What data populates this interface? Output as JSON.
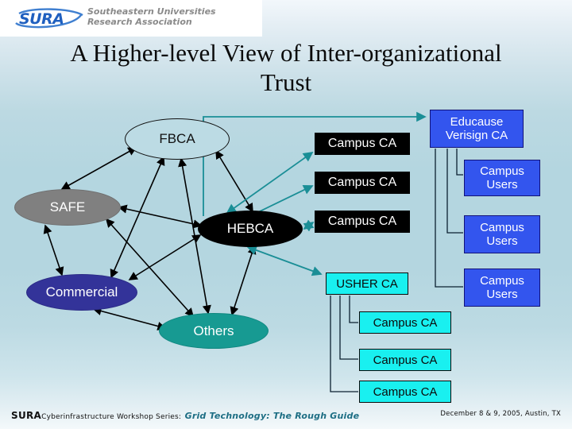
{
  "slide": {
    "title": "A Higher-level View of\nInter-organizational Trust",
    "background_top": "#f2f7fb",
    "background_mid": "#b4d6e0"
  },
  "logo": {
    "wordmark": "SURA",
    "subtitle": "Southeastern Universities\nResearch Association",
    "mark_color": "#1f5fbf",
    "subtitle_color": "#8a8a8a"
  },
  "diagram": {
    "mesh": {
      "fbca": {
        "label": "FBCA",
        "fill": "#bcdbe4",
        "text": "#111111",
        "shape": "ellipse"
      },
      "safe": {
        "label": "SAFE",
        "fill": "#808080",
        "text": "#ffffff",
        "shape": "ellipse"
      },
      "hebca": {
        "label": "HEBCA",
        "fill": "#000000",
        "text": "#ffffff",
        "shape": "ellipse"
      },
      "commercial": {
        "label": "Commercial",
        "fill": "#333399",
        "text": "#ffffff",
        "shape": "ellipse"
      },
      "others": {
        "label": "Others",
        "fill": "#179a92",
        "text": "#ffffff",
        "shape": "ellipse"
      }
    },
    "hebca_campus_cas": [
      {
        "label": "Campus CA",
        "fill": "#000000",
        "text": "#ffffff"
      },
      {
        "label": "Campus CA",
        "fill": "#000000",
        "text": "#ffffff"
      },
      {
        "label": "Campus CA",
        "fill": "#000000",
        "text": "#ffffff"
      }
    ],
    "educause": {
      "label": "Educause\nVerisign CA",
      "fill": "#3355ee",
      "text": "#ffffff",
      "border": "#121278"
    },
    "campus_users": [
      {
        "label": "Campus\nUsers",
        "fill": "#3355ee",
        "text": "#ffffff"
      },
      {
        "label": "Campus\nUsers",
        "fill": "#3355ee",
        "text": "#ffffff"
      },
      {
        "label": "Campus\nUsers",
        "fill": "#3355ee",
        "text": "#ffffff"
      }
    ],
    "usher": {
      "label": "USHER CA",
      "fill": "#19f0f0",
      "text": "#0b0b0b"
    },
    "usher_campus_cas": [
      {
        "label": "Campus CA",
        "fill": "#19f0f0",
        "text": "#0b0b0b"
      },
      {
        "label": "Campus CA",
        "fill": "#19f0f0",
        "text": "#0b0b0b"
      },
      {
        "label": "Campus CA",
        "fill": "#19f0f0",
        "text": "#0b0b0b"
      }
    ],
    "connector_colors": {
      "mesh_arrow": "#000000",
      "hebca_arrow": "#1a8e96",
      "tree_line": "#0b2030"
    }
  },
  "footer": {
    "org": "SURA",
    "series": "Cyberinfrastructure Workshop Series:",
    "talk_title": "Grid Technology: The Rough Guide",
    "date_location": "December 8 & 9, 2005, Austin, TX",
    "talk_color": "#1d6e84"
  }
}
